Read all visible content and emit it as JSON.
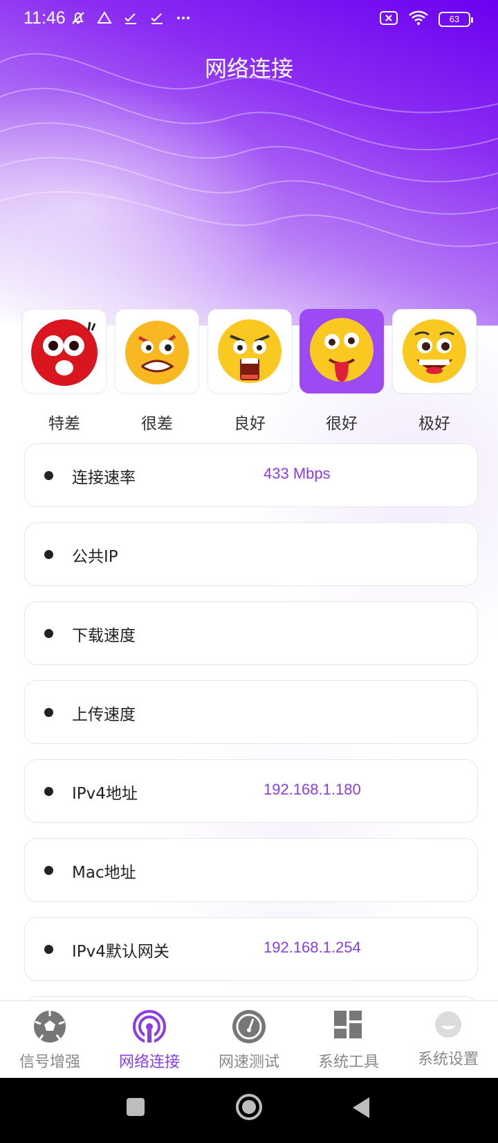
{
  "status_bar": {
    "time": "11:46",
    "battery": "63",
    "icons": [
      "mute-notification-icon",
      "drive-icon",
      "check-icon",
      "check-icon",
      "more-icon",
      "sim-off-icon",
      "wifi-icon",
      "battery-icon"
    ]
  },
  "page": {
    "title": "网络连接"
  },
  "ratings": {
    "selected_index": 3,
    "items": [
      {
        "label": "特差",
        "icon": "shocked-red-face-icon"
      },
      {
        "label": "很差",
        "icon": "angry-face-icon"
      },
      {
        "label": "良好",
        "icon": "screaming-face-icon"
      },
      {
        "label": "很好",
        "icon": "tongue-out-face-icon"
      },
      {
        "label": "极好",
        "icon": "grinning-face-icon"
      }
    ]
  },
  "info_rows": [
    {
      "label": "连接速率",
      "value": "433 Mbps"
    },
    {
      "label": "公共IP",
      "value": ""
    },
    {
      "label": "下载速度",
      "value": ""
    },
    {
      "label": "上传速度",
      "value": ""
    },
    {
      "label": "IPv4地址",
      "value": "192.168.1.180"
    },
    {
      "label": "Mac地址",
      "value": ""
    },
    {
      "label": "IPv4默认网关",
      "value": "192.168.1.254"
    }
  ],
  "bottom_nav": {
    "active_index": 1,
    "items": [
      {
        "label": "信号增强",
        "icon": "football-icon"
      },
      {
        "label": "网络连接",
        "icon": "broadcast-icon"
      },
      {
        "label": "网速测试",
        "icon": "speedometer-icon"
      },
      {
        "label": "系统工具",
        "icon": "grid-icon"
      },
      {
        "label": "系统设置",
        "icon": "settings-icon"
      }
    ]
  },
  "colors": {
    "accent": "#8a3ce6",
    "selected_card": "#9b4af4",
    "hero_top": "#6a00f0"
  }
}
